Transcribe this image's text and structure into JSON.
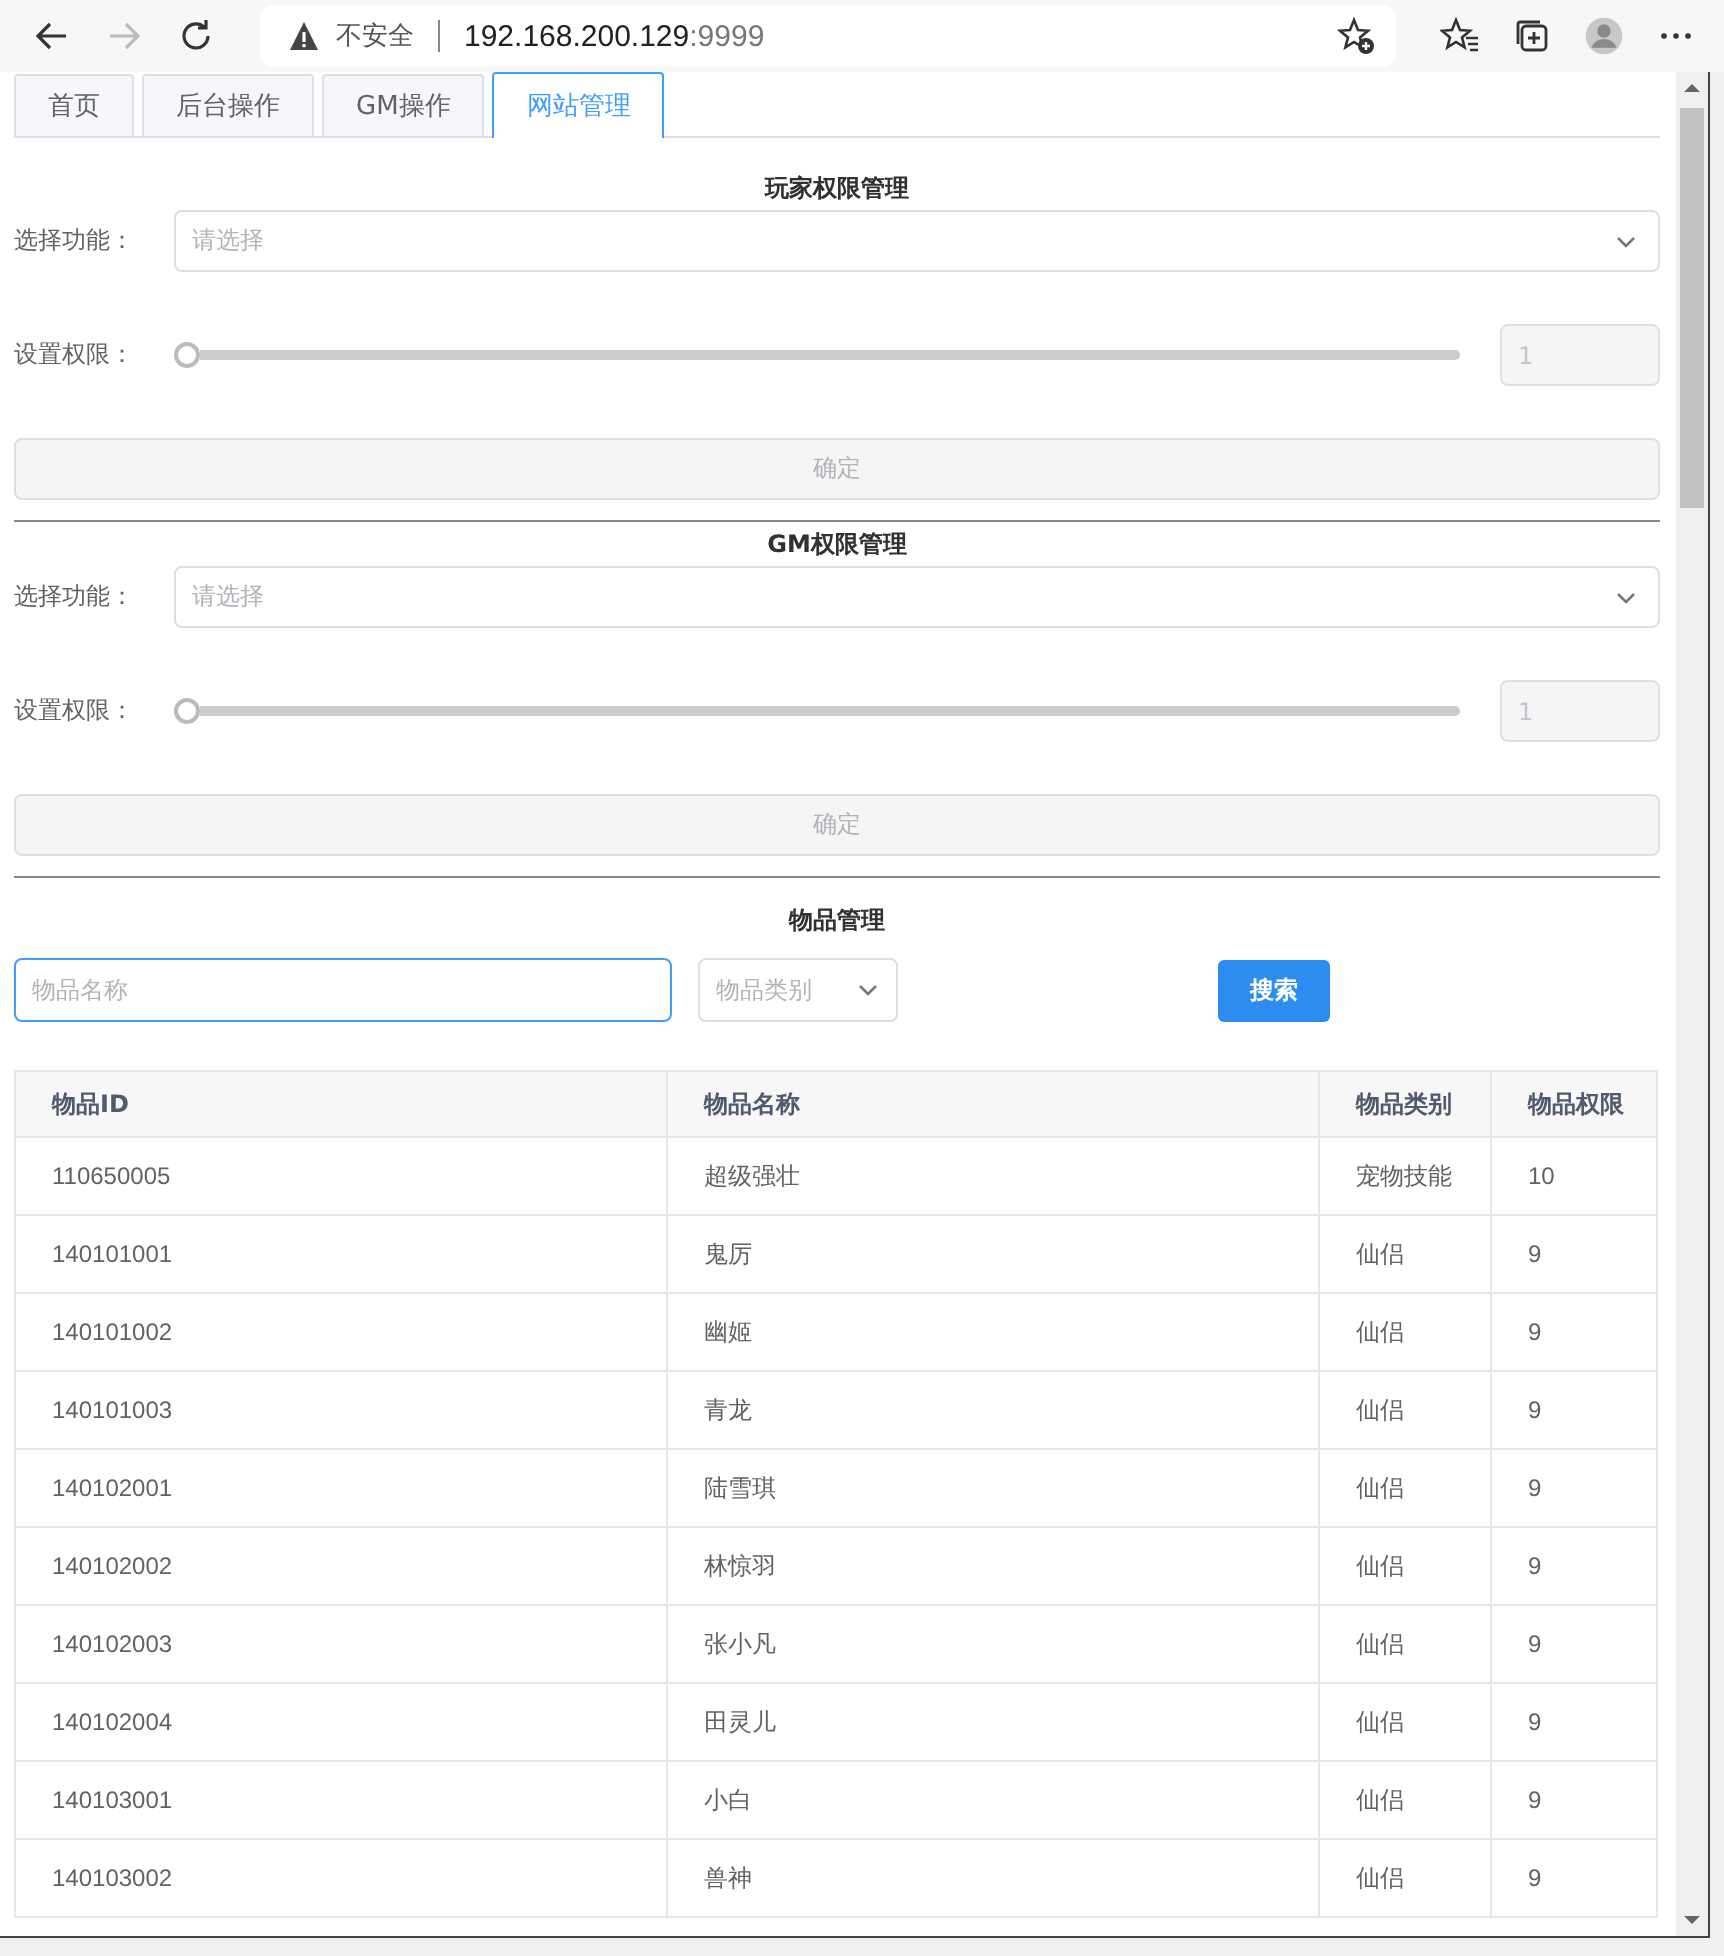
{
  "browser": {
    "security": "不安全",
    "url_host": "192.168.200.129",
    "url_port": ":9999"
  },
  "tabs": [
    {
      "label": "首页",
      "selected": false
    },
    {
      "label": "后台操作",
      "selected": false
    },
    {
      "label": "GM操作",
      "selected": false
    },
    {
      "label": "网站管理",
      "selected": true
    }
  ],
  "permission_sections": [
    {
      "title": "玩家权限管理",
      "function_label": "选择功能：",
      "function_placeholder": "请选择",
      "level_label": "设置权限：",
      "slider": {
        "level": 0
      },
      "level_value": "1",
      "level_disabled": true,
      "confirm": {
        "label": "确定",
        "disabled": true
      }
    },
    {
      "title": "GM权限管理",
      "function_label": "选择功能：",
      "function_placeholder": "请选择",
      "level_label": "设置权限：",
      "slider": {
        "level": 0
      },
      "level_value": "1",
      "level_disabled": true,
      "confirm": {
        "label": "确定",
        "disabled": true
      }
    }
  ],
  "items": {
    "title": "物品管理",
    "name_placeholder": "物品名称",
    "category_placeholder": "物品类别",
    "search_button": "搜索",
    "table": {
      "columns": [
        "物品ID",
        "物品名称",
        "物品类别",
        "物品权限"
      ],
      "rows": [
        [
          "110650005",
          "超级强壮",
          "宠物技能",
          "10"
        ],
        [
          "140101001",
          "鬼厉",
          "仙侣",
          "9"
        ],
        [
          "140101002",
          "幽姬",
          "仙侣",
          "9"
        ],
        [
          "140101003",
          "青龙",
          "仙侣",
          "9"
        ],
        [
          "140102001",
          "陆雪琪",
          "仙侣",
          "9"
        ],
        [
          "140102002",
          "林惊羽",
          "仙侣",
          "9"
        ],
        [
          "140102003",
          "张小凡",
          "仙侣",
          "9"
        ],
        [
          "140102004",
          "田灵儿",
          "仙侣",
          "9"
        ],
        [
          "140103001",
          "小白",
          "仙侣",
          "9"
        ],
        [
          "140103002",
          "兽神",
          "仙侣",
          "9"
        ]
      ]
    }
  }
}
